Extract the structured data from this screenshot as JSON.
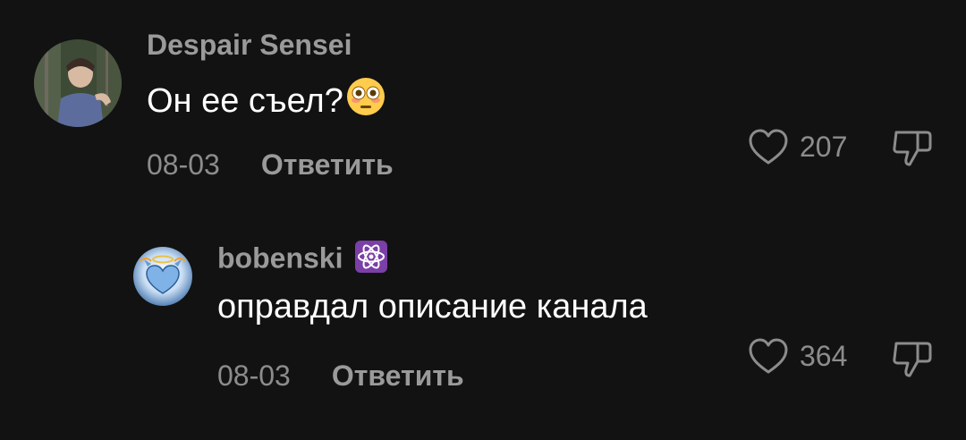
{
  "comments": [
    {
      "username": "Despair Sensei",
      "text": "Он ее съел?",
      "emoji": "flushed-face-emoji",
      "date": "08-03",
      "reply_label": "Ответить",
      "likes": "207"
    },
    {
      "username": "bobenski",
      "badge": "atom-symbol-emoji",
      "text": "оправдал описание канала",
      "date": "08-03",
      "reply_label": "Ответить",
      "likes": "364"
    }
  ],
  "colors": {
    "background": "#121212",
    "username": "#9a9a9a",
    "meta": "#8c8c8c",
    "text": "#ffffff",
    "badge": "#7b3fa8"
  }
}
